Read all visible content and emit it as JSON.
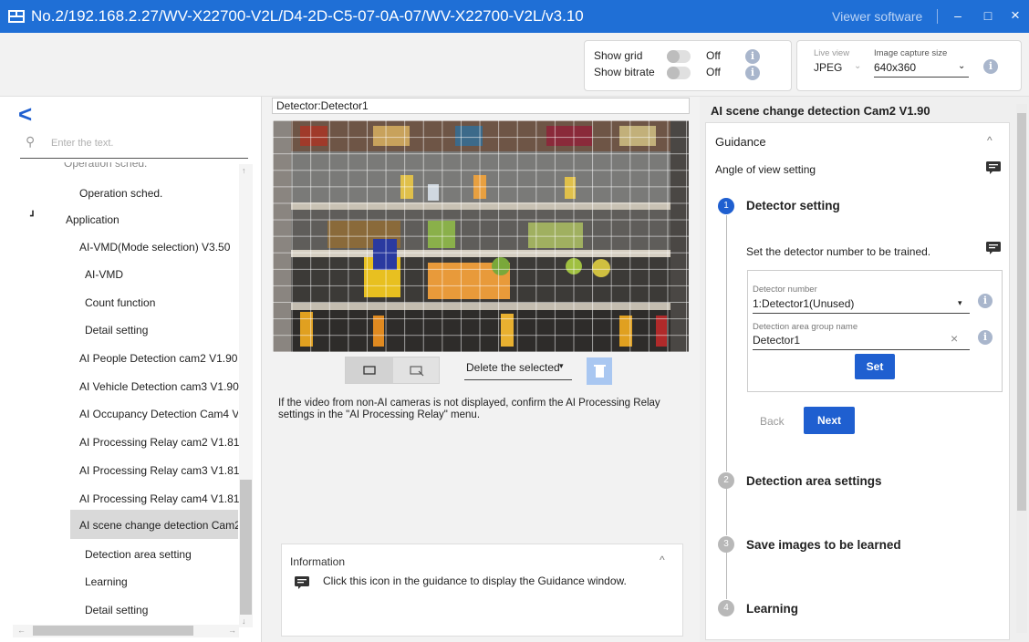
{
  "window": {
    "title": "No.2/192.168.2.27/WV-X22700-V2L/D4-2D-C5-07-0A-07/WV-X22700-V2L/v3.10",
    "app_name": "Viewer software",
    "minimize": "–",
    "maximize": "□",
    "close": "×"
  },
  "toolbar": {
    "show_grid_label": "Show grid",
    "show_grid_value": "Off",
    "show_bitrate_label": "Show bitrate",
    "show_bitrate_value": "Off",
    "live_view_label": "Live view",
    "live_view_value": "JPEG",
    "capture_size_label": "Image capture size",
    "capture_size_value": "640x360"
  },
  "left": {
    "search_placeholder": "Enter the text.",
    "tree": [
      {
        "label": "Operation sched.",
        "level": 2
      },
      {
        "label": "Operation sched.",
        "level": 2
      },
      {
        "label": "Application",
        "level": 1,
        "expanded": true
      },
      {
        "label": "AI-VMD(Mode selection) V3.50",
        "level": 2
      },
      {
        "label": "AI-VMD",
        "level": 3
      },
      {
        "label": "Count function",
        "level": 3
      },
      {
        "label": "Detail setting",
        "level": 3
      },
      {
        "label": "AI People Detection cam2 V1.90",
        "level": 2
      },
      {
        "label": "AI Vehicle Detection cam3 V1.90",
        "level": 2
      },
      {
        "label": "AI Occupancy Detection Cam4 V",
        "level": 2
      },
      {
        "label": "AI Processing Relay cam2 V1.81",
        "level": 2
      },
      {
        "label": "AI Processing Relay cam3 V1.81",
        "level": 2
      },
      {
        "label": "AI Processing Relay cam4 V1.81",
        "level": 2
      },
      {
        "label": "AI scene change detection Cam2",
        "level": 2,
        "selected": true
      },
      {
        "label": "Detection area setting",
        "level": 3
      },
      {
        "label": "Learning",
        "level": 3
      },
      {
        "label": "Detail setting",
        "level": 3
      }
    ]
  },
  "center": {
    "detector_label": "Detector:Detector1",
    "delete_selected": "Delete the selected",
    "notice": "If the video from non-AI cameras is not displayed, confirm the AI Processing Relay settings in the \"AI Processing Relay\" menu.",
    "info_title": "Information",
    "info_text": "Click this icon in the guidance to display the Guidance window."
  },
  "right": {
    "heading": "AI scene change detection Cam2 V1.90",
    "guidance_title": "Guidance",
    "angle_of_view": "Angle of view setting",
    "steps": [
      {
        "num": "1",
        "title": "Detector setting",
        "active": true
      },
      {
        "num": "2",
        "title": "Detection area settings",
        "active": false
      },
      {
        "num": "3",
        "title": "Save images to be learned",
        "active": false
      },
      {
        "num": "4",
        "title": "Learning",
        "active": false
      }
    ],
    "step1_desc": "Set the detector number to be trained.",
    "detector_number_label": "Detector number",
    "detector_number_value": "1:Detector1(Unused)",
    "group_name_label": "Detection area group name",
    "group_name_value": "Detector1",
    "set_button": "Set",
    "back_button": "Back",
    "next_button": "Next"
  },
  "colors": {
    "titlebar": "#1f6fd6",
    "accent": "#1f5fd0",
    "step_inactive": "#b8b8b8"
  }
}
